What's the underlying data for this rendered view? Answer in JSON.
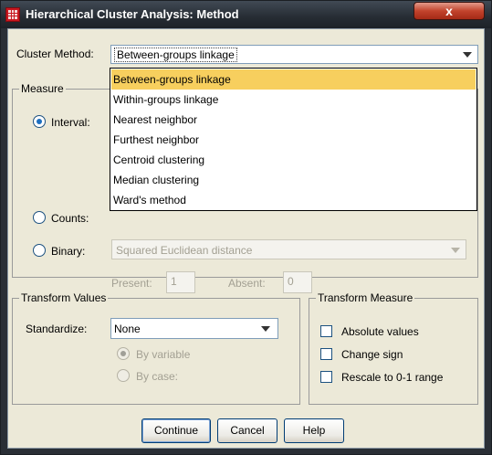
{
  "window": {
    "title": "Hierarchical Cluster Analysis: Method",
    "close_label": "x"
  },
  "cluster_method": {
    "label": "Cluster Method:",
    "selected": "Between-groups linkage",
    "options": [
      "Between-groups linkage",
      "Within-groups linkage",
      "Nearest neighbor",
      "Furthest neighbor",
      "Centroid clustering",
      "Median clustering",
      "Ward's method"
    ]
  },
  "measure": {
    "legend": "Measure",
    "interval_label": "Interval:",
    "counts_label": "Counts:",
    "binary_label": "Binary:",
    "binary_measure": "Squared Euclidean distance",
    "present_label": "Present:",
    "present_value": "1",
    "absent_label": "Absent:",
    "absent_value": "0"
  },
  "transform_values": {
    "legend": "Transform Values",
    "standardize_label": "Standardize:",
    "standardize_value": "None",
    "by_variable_label": "By variable",
    "by_case_label": "By case:"
  },
  "transform_measure": {
    "legend": "Transform Measure",
    "absolute_values_label": "Absolute values",
    "change_sign_label": "Change sign",
    "rescale_label": "Rescale to 0-1 range"
  },
  "buttons": {
    "continue": "Continue",
    "cancel": "Cancel",
    "help": "Help"
  },
  "colors": {
    "dialog_bg": "#ece9d8",
    "highlight": "#f7cf5e",
    "titlebar": "#262c33"
  }
}
